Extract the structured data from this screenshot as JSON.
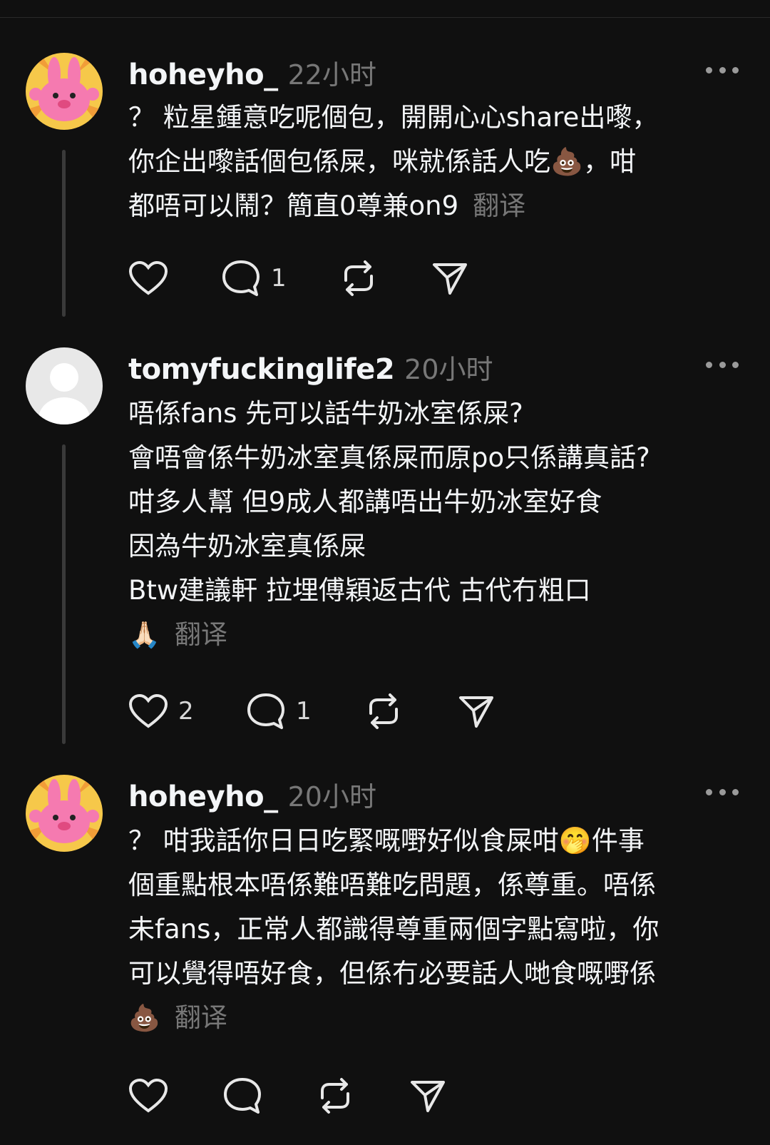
{
  "posts": [
    {
      "username": "hoheyho_",
      "time": "22小时",
      "lines": [
        "？ 粒星鍾意吃呢個包，開開心心share出嚟，",
        "你企出嚟話個包係屎，咪就係話人吃💩，咁",
        "都唔可以鬧？簡直0尊兼on9"
      ],
      "translate": "翻译",
      "likes": "",
      "replies": "1"
    },
    {
      "username": "tomyfuckinglife2",
      "time": "20小时",
      "lines": [
        "唔係fans 先可以話牛奶冰室係屎?",
        "會唔會係牛奶冰室真係屎而原po只係講真話?",
        "咁多人幫 但9成人都講唔出牛奶冰室好食",
        "因為牛奶冰室真係屎",
        "Btw建議軒 拉埋傅穎返古代 古代冇粗口",
        "🙏🏻"
      ],
      "translate": "翻译",
      "likes": "2",
      "replies": "1"
    },
    {
      "username": "hoheyho_",
      "time": "20小时",
      "lines": [
        "？ 咁我話你日日吃緊嘅嘢好似食屎咁🤭件事",
        "個重點根本唔係難唔難吃問題，係尊重。唔係",
        "未fans，正常人都識得尊重兩個字點寫啦，你",
        "可以覺得唔好食，但係冇必要話人哋食嘅嘢係",
        "💩"
      ],
      "translate": "翻译",
      "likes": "",
      "replies": ""
    }
  ]
}
